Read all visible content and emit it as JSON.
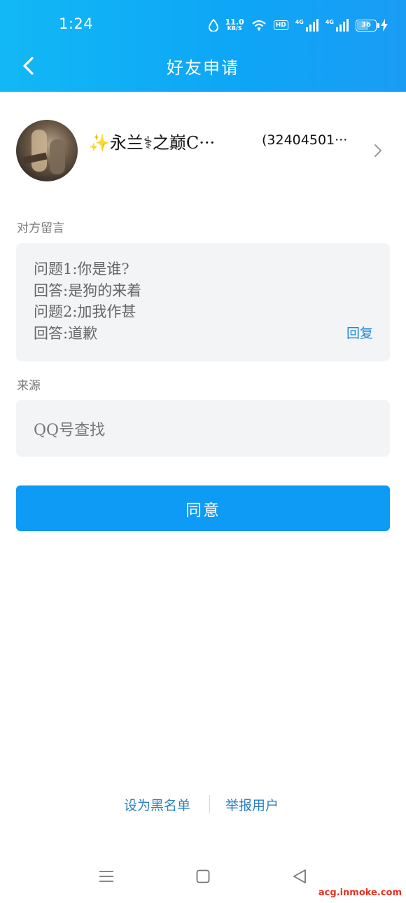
{
  "status_bar": {
    "time": "1:24",
    "net_speed_value": "11.0",
    "net_speed_unit": "KB/S",
    "hd_label": "HD",
    "signal1_label": "4G",
    "signal2_label": "4G",
    "battery_level": "36"
  },
  "header": {
    "title": "好友申请",
    "back_icon": "chevron-left-icon"
  },
  "profile": {
    "nickname": "✨永兰⚕之巅C···",
    "qq_number": "(32404501···",
    "chevron_icon": "chevron-right-icon"
  },
  "message": {
    "label": "对方留言",
    "lines": [
      "问题1:你是谁?",
      "回答:是狗的来着",
      "问题2:加我作甚",
      "回答:道歉"
    ],
    "reply_label": "回复"
  },
  "source": {
    "label": "来源",
    "value": "QQ号查找"
  },
  "agree_button_label": "同意",
  "footer": {
    "blacklist_label": "设为黑名单",
    "report_label": "举报用户"
  },
  "nav": {
    "menu_icon": "menu-icon",
    "home_icon": "home-square-icon",
    "back_icon": "back-triangle-icon"
  },
  "watermark": "acg.inmoke.com",
  "colors": {
    "header": "#0ea5f6",
    "button": "#0d9bf6",
    "link": "#2a7fc0",
    "box_bg": "#f3f4f6"
  }
}
